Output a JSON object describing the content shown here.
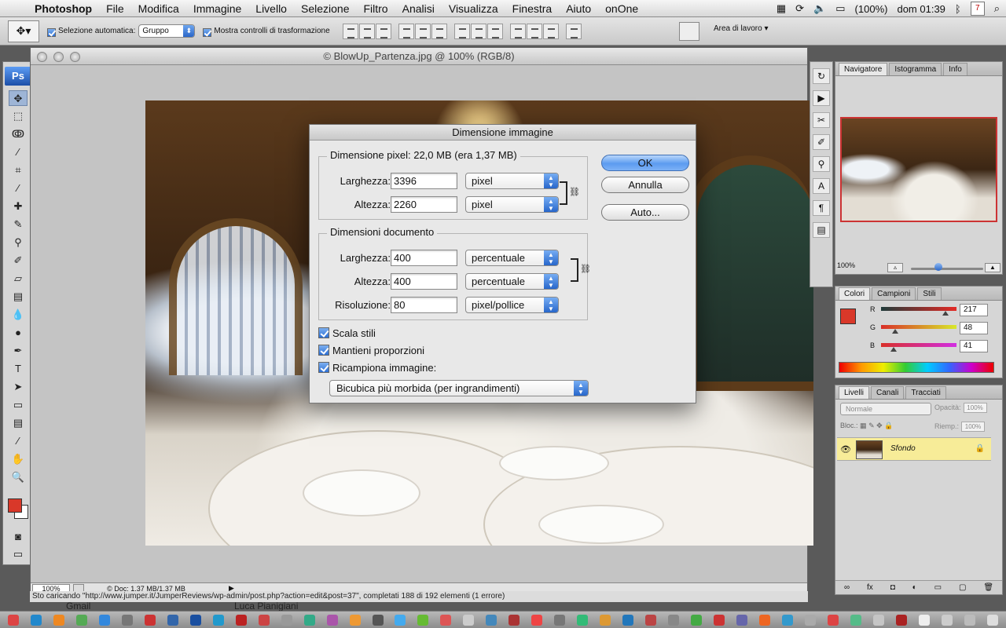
{
  "menubar": {
    "app": "Photoshop",
    "items": [
      "File",
      "Modifica",
      "Immagine",
      "Livello",
      "Selezione",
      "Filtro",
      "Analisi",
      "Visualizza",
      "Finestra",
      "Aiuto",
      "onOne"
    ],
    "battery": "(100%)",
    "clock": "dom 01:39",
    "calendar_day": "7"
  },
  "optionsbar": {
    "auto_select_label": "Selezione automatica:",
    "auto_select_value": "Gruppo",
    "show_transform_label": "Mostra controlli di trasformazione",
    "workspace_label": "Area di lavoro"
  },
  "tools": {
    "logo": "Ps"
  },
  "document": {
    "title": "© BlowUp_Partenza.jpg @ 100% (RGB/8)",
    "zoom": "100%",
    "doc_info": "© Doc: 1,37 MB/1,37 MB"
  },
  "browser_status": {
    "loading_text": "Sto caricando \"http://www.jumper.it/JumperReviews/wp-admin/post.php?action=edit&post=37\", completati 188 di 192 elementi (1 errore)",
    "gmail": "Gmail",
    "user": "Luca Pianigiani"
  },
  "navigator": {
    "tabs": [
      "Navigatore",
      "Istogramma",
      "Info"
    ],
    "zoom": "100%"
  },
  "colors_panel": {
    "tabs": [
      "Colori",
      "Campioni",
      "Stili"
    ],
    "r_label": "R",
    "g_label": "G",
    "b_label": "B",
    "r": "217",
    "g": "48",
    "b": "41",
    "fg_color": "#d93829"
  },
  "layers_panel": {
    "tabs": [
      "Livelli",
      "Canali",
      "Tracciati"
    ],
    "blend_mode": "Normale",
    "opacity_label": "Opacità:",
    "opacity_value": "100%",
    "lock_label": "Bloc.:",
    "fill_label": "Riemp.:",
    "fill_value": "100%",
    "layer_name": "Sfondo"
  },
  "dialog": {
    "title": "Dimensione immagine",
    "pixel_dims_title": "Dimensione pixel:  22,0 MB (era 1,37 MB)",
    "pixel_width_label": "Larghezza:",
    "pixel_width_value": "3396",
    "pixel_width_unit": "pixel",
    "pixel_height_label": "Altezza:",
    "pixel_height_value": "2260",
    "pixel_height_unit": "pixel",
    "doc_dims_title": "Dimensioni documento",
    "doc_width_label": "Larghezza:",
    "doc_width_value": "400",
    "doc_width_unit": "percentuale",
    "doc_height_label": "Altezza:",
    "doc_height_value": "400",
    "doc_height_unit": "percentuale",
    "resolution_label": "Risoluzione:",
    "resolution_value": "80",
    "resolution_unit": "pixel/pollice",
    "scale_styles": "Scala stili",
    "constrain": "Mantieni proporzioni",
    "resample": "Ricampiona immagine:",
    "resample_method": "Bicubica più morbida (per ingrandimenti)",
    "ok": "OK",
    "cancel": "Annulla",
    "auto": "Auto..."
  }
}
